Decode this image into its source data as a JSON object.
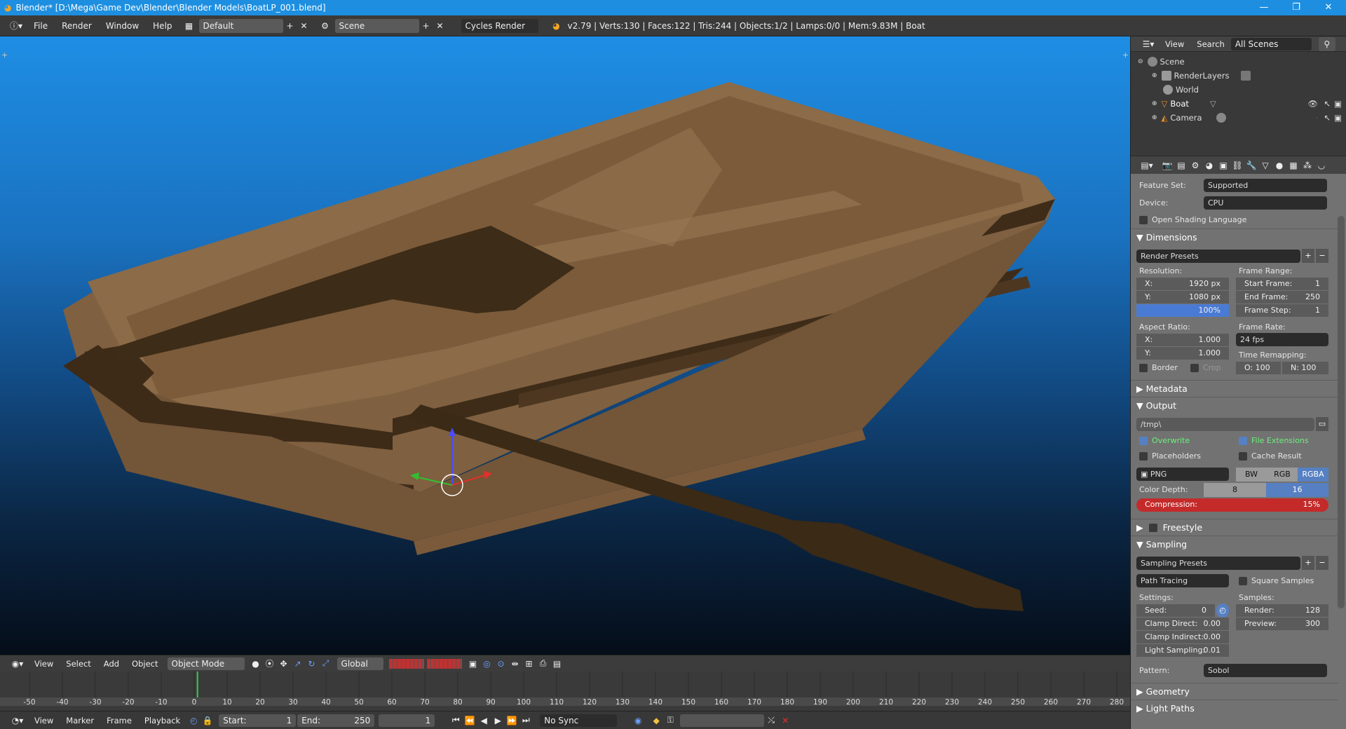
{
  "title_bar": {
    "title": "Blender* [D:\\Mega\\Game Dev\\Blender\\Blender Models\\BoatLP_001.blend]"
  },
  "info_header": {
    "menus": [
      "File",
      "Render",
      "Window",
      "Help"
    ],
    "layout": "Default",
    "scene": "Scene",
    "engine": "Cycles Render",
    "stats": "v2.79 | Verts:130 | Faces:122 | Tris:244 | Objects:1/2 | Lamps:0/0 | Mem:9.83M | Boat"
  },
  "outliner": {
    "header": {
      "view": "View",
      "search": "Search",
      "filter": "All Scenes"
    },
    "items": [
      {
        "label": "Scene",
        "icon": "scene-icon"
      },
      {
        "label": "RenderLayers",
        "icon": "renderlayers-icon"
      },
      {
        "label": "World",
        "icon": "world-icon"
      },
      {
        "label": "Boat",
        "icon": "mesh-object-icon"
      },
      {
        "label": "Camera",
        "icon": "camera-object-icon"
      }
    ]
  },
  "properties": {
    "feature_set_label": "Feature Set:",
    "feature_set": "Supported",
    "device_label": "Device:",
    "device": "CPU",
    "osl": "Open Shading Language",
    "dimensions": {
      "title": "Dimensions",
      "presets": "Render Presets",
      "resolution_label": "Resolution:",
      "res_x": "X:",
      "res_x_val": "1920 px",
      "res_y": "Y:",
      "res_y_val": "1080 px",
      "res_pct": "100%",
      "aspect_label": "Aspect Ratio:",
      "asp_x": "X:",
      "asp_x_val": "1.000",
      "asp_y": "Y:",
      "asp_y_val": "1.000",
      "border": "Border",
      "crop": "Crop",
      "frame_range_label": "Frame Range:",
      "start_frame": "Start Frame:",
      "start_frame_val": "1",
      "end_frame": "End Frame:",
      "end_frame_val": "250",
      "frame_step": "Frame Step:",
      "frame_step_val": "1",
      "frame_rate_label": "Frame Rate:",
      "frame_rate": "24 fps",
      "time_remap_label": "Time Remapping:",
      "old": "O: 100",
      "new": "N: 100"
    },
    "metadata": {
      "title": "Metadata"
    },
    "output": {
      "title": "Output",
      "path": "/tmp\\",
      "overwrite": "Overwrite",
      "file_ext": "File Extensions",
      "placeholders": "Placeholders",
      "cache": "Cache Result",
      "format": "PNG",
      "bw": "BW",
      "rgb": "RGB",
      "rgba": "RGBA",
      "color_depth_label": "Color Depth:",
      "depth8": "8",
      "depth16": "16",
      "compression": "Compression:",
      "compression_val": "15%"
    },
    "freestyle": {
      "title": "Freestyle"
    },
    "sampling": {
      "title": "Sampling",
      "presets": "Sampling Presets",
      "integrator": "Path Tracing",
      "square": "Square Samples",
      "settings_label": "Settings:",
      "samples_label": "Samples:",
      "seed": "Seed:",
      "seed_val": "0",
      "clamp_direct": "Clamp Direct:",
      "clamp_direct_val": "0.00",
      "clamp_indirect": "Clamp Indirect:",
      "clamp_indirect_val": "0.00",
      "light_sampling": "Light Sampling:",
      "light_sampling_val": "0.01",
      "render": "Render:",
      "render_val": "128",
      "preview": "Preview:",
      "preview_val": "300",
      "pattern_label": "Pattern:",
      "pattern": "Sobol"
    },
    "geometry": {
      "title": "Geometry"
    },
    "light_paths": {
      "title": "Light Paths"
    }
  },
  "view3d_header": {
    "menus": [
      "View",
      "Select",
      "Add",
      "Object"
    ],
    "mode": "Object Mode",
    "orientation": "Global"
  },
  "timeline": {
    "ticks": [
      "-50",
      "-40",
      "-30",
      "-20",
      "-10",
      "0",
      "10",
      "20",
      "30",
      "40",
      "50",
      "60",
      "70",
      "80",
      "90",
      "100",
      "110",
      "120",
      "130",
      "140",
      "150",
      "160",
      "170",
      "180",
      "190",
      "200",
      "210",
      "220",
      "230",
      "240",
      "250",
      "260",
      "270",
      "280"
    ],
    "current_frame": 1
  },
  "timeline_header": {
    "menus": [
      "View",
      "Marker",
      "Frame",
      "Playback"
    ],
    "start_label": "Start:",
    "start_val": "1",
    "end_label": "End:",
    "end_val": "250",
    "current": "1",
    "sync": "No Sync"
  },
  "colors": {
    "accent": "#5680c2",
    "title_bar": "#1e8fe0",
    "boat": "#8a6a46",
    "compression": "#c42a2a"
  }
}
